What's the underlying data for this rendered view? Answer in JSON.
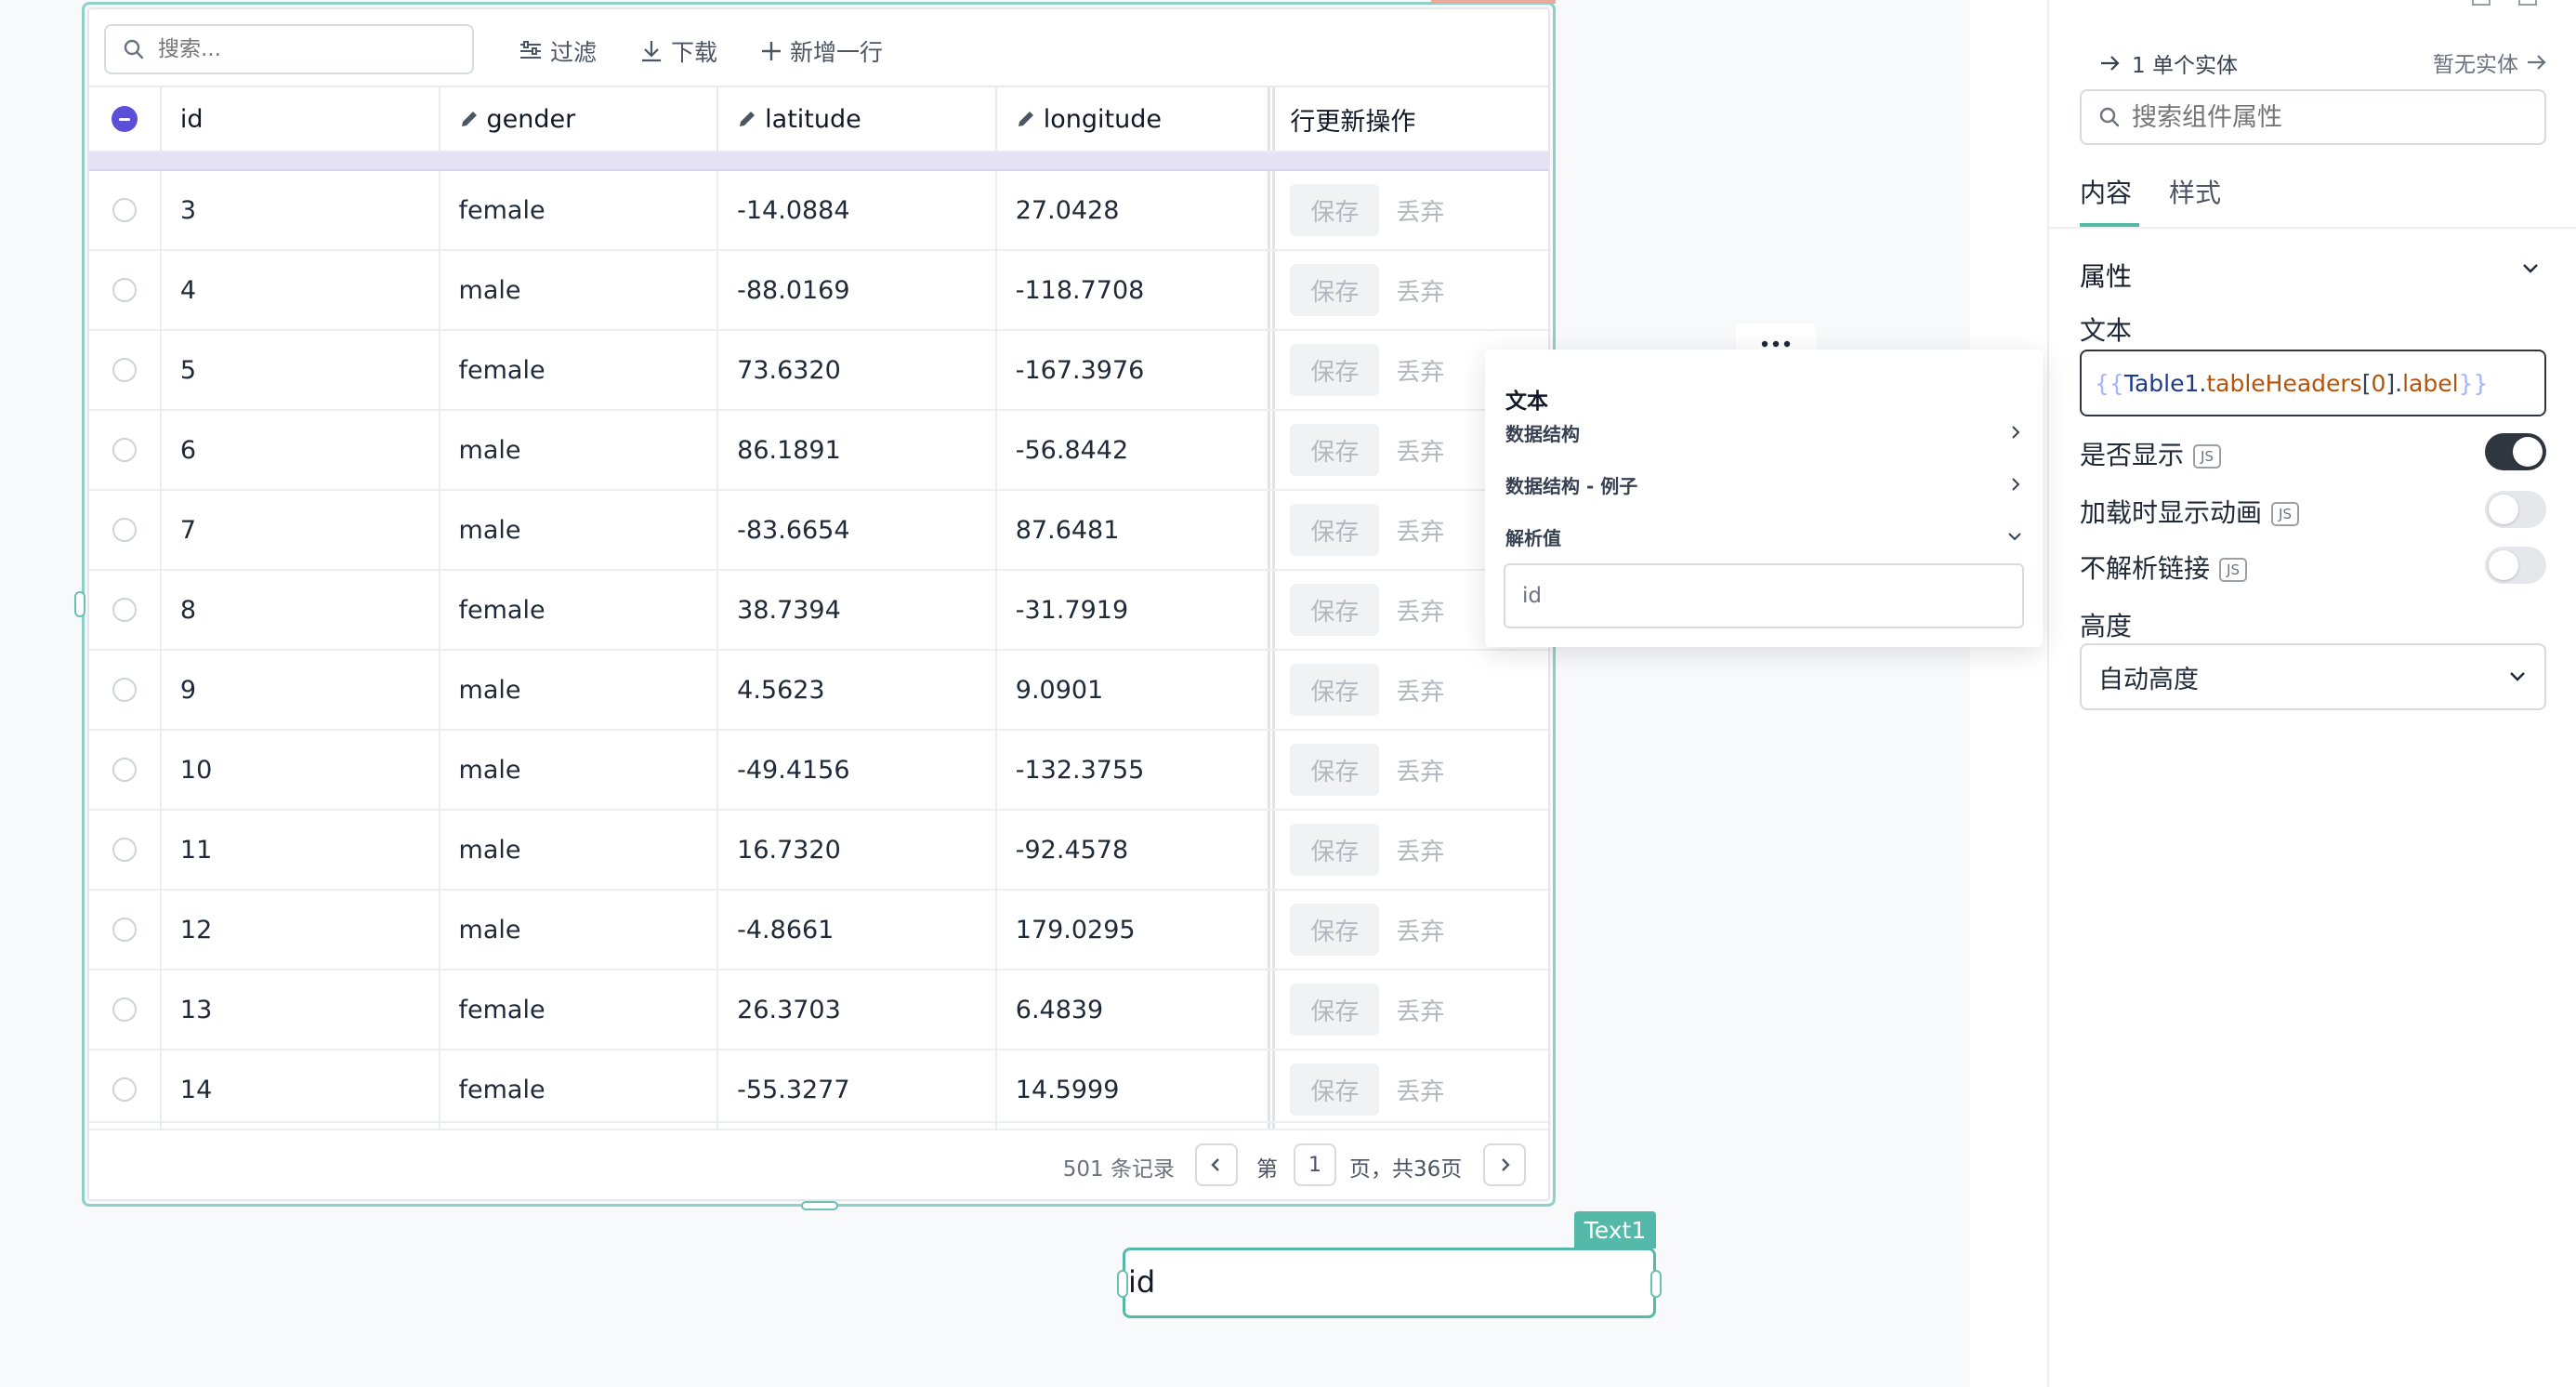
{
  "toolbar": {
    "search_placeholder": "搜索...",
    "filter_label": "过滤",
    "download_label": "下载",
    "add_row_label": "新增一行"
  },
  "table": {
    "columns": [
      "id",
      "gender",
      "latitude",
      "longitude",
      "行更新操作"
    ],
    "rows": [
      {
        "id": "3",
        "gender": "female",
        "latitude": "-14.0884",
        "longitude": "27.0428"
      },
      {
        "id": "4",
        "gender": "male",
        "latitude": "-88.0169",
        "longitude": "-118.7708"
      },
      {
        "id": "5",
        "gender": "female",
        "latitude": "73.6320",
        "longitude": "-167.3976"
      },
      {
        "id": "6",
        "gender": "male",
        "latitude": "86.1891",
        "longitude": "-56.8442"
      },
      {
        "id": "7",
        "gender": "male",
        "latitude": "-83.6654",
        "longitude": "87.6481"
      },
      {
        "id": "8",
        "gender": "female",
        "latitude": "38.7394",
        "longitude": "-31.7919"
      },
      {
        "id": "9",
        "gender": "male",
        "latitude": "4.5623",
        "longitude": "9.0901"
      },
      {
        "id": "10",
        "gender": "male",
        "latitude": "-49.4156",
        "longitude": "-132.3755"
      },
      {
        "id": "11",
        "gender": "male",
        "latitude": "16.7320",
        "longitude": "-92.4578"
      },
      {
        "id": "12",
        "gender": "male",
        "latitude": "-4.8661",
        "longitude": "179.0295"
      },
      {
        "id": "13",
        "gender": "female",
        "latitude": "26.3703",
        "longitude": "6.4839"
      },
      {
        "id": "14",
        "gender": "female",
        "latitude": "-55.3277",
        "longitude": "14.5999"
      }
    ],
    "save_label": "保存",
    "discard_label": "丢弃"
  },
  "pagination": {
    "records": "501 条记录",
    "page_prefix": "第",
    "page_value": "1",
    "page_suffix": "页，共36页"
  },
  "popover": {
    "title": "文本",
    "items": [
      "数据结构",
      "数据结构 - 例子",
      "解析值"
    ],
    "value": "id"
  },
  "text_widget": {
    "tag": "Text1",
    "content": "id"
  },
  "right_panel": {
    "entity_count": "1 单个实体",
    "no_entity": "暂无实体",
    "search_placeholder": "搜索组件属性",
    "tabs": [
      "内容",
      "样式"
    ],
    "section_title": "属性",
    "text_label": "文本",
    "text_binding": {
      "open": "{{",
      "obj": "Table1",
      "dot1": ".",
      "prop": "tableHeaders",
      "idx_open": "[",
      "idx": "0",
      "idx_close": "]",
      "dot2": ".",
      "leaf": "label",
      "close": "}}"
    },
    "visible_label": "是否显示",
    "loading_label": "加载时显示动画",
    "no_parse_label": "不解析链接",
    "js_badge": "JS",
    "height_label": "高度",
    "height_value": "自动高度",
    "toggles": {
      "visible": true,
      "loading": false,
      "no_parse": false
    }
  },
  "colors": {
    "accent": "#54b9a9",
    "select_purple": "#5b4fd8",
    "toggle_on": "#2f3640",
    "toggle_off": "#e5e7eb"
  }
}
